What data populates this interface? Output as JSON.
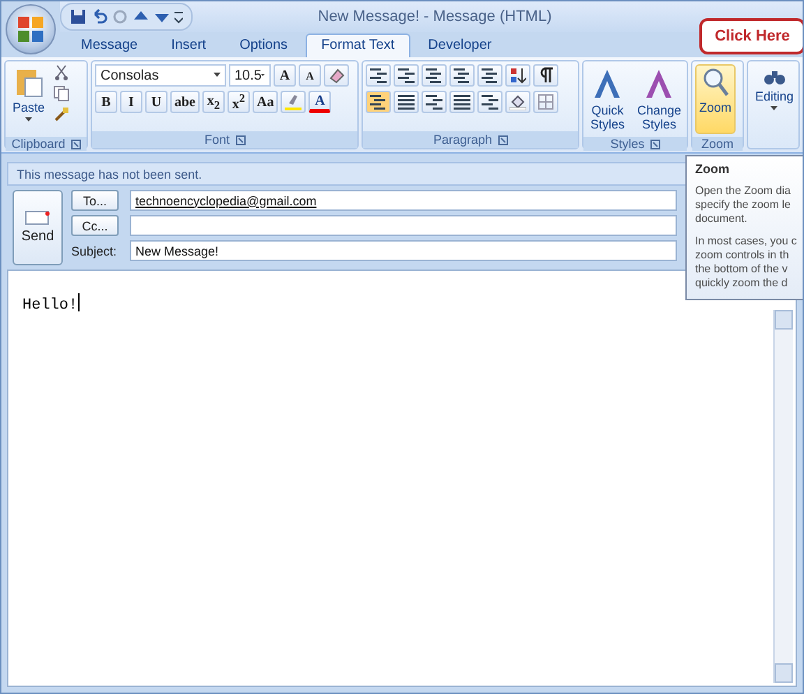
{
  "window": {
    "title": "New Message! - Message (HTML)"
  },
  "tabs": [
    {
      "label": "Message",
      "selected": false
    },
    {
      "label": "Insert",
      "selected": false
    },
    {
      "label": "Options",
      "selected": false
    },
    {
      "label": "Format Text",
      "selected": true
    },
    {
      "label": "Developer",
      "selected": false
    }
  ],
  "clipboard": {
    "label": "Clipboard",
    "paste": "Paste"
  },
  "font": {
    "label": "Font",
    "font_name": "Consolas",
    "font_size": "10.5",
    "grow": "A",
    "shrink": "A",
    "styles": [
      "B",
      "I",
      "U",
      "abe",
      "x$_{2}$",
      "x$^{2}$",
      "Aa"
    ],
    "color_label": "A"
  },
  "paragraph": {
    "label": "Paragraph"
  },
  "styles": {
    "label": "Styles",
    "buttons": [
      "Quick Styles",
      "Change Styles"
    ]
  },
  "zoom": {
    "label": "Zoom",
    "button": "Zoom",
    "highlighted": true
  },
  "editing": {
    "button": "Editing"
  },
  "info_bar": "This message has not been sent.",
  "send": "Send",
  "to": {
    "button": "To...",
    "value": "technoencyclopedia@gmail.com"
  },
  "cc": {
    "button": "Cc..."
  },
  "subject": {
    "label": "Subject:",
    "value": "New Message!"
  },
  "body": "Hello!",
  "callout": "Click Here",
  "tooltip": {
    "title": "Zoom",
    "paragraphs": [
      [
        "Open the Zoom dia",
        "specify the zoom le",
        "document."
      ],
      [
        "In most cases, you c",
        "zoom controls in th",
        "the bottom of the v",
        "quickly zoom the d"
      ]
    ]
  }
}
